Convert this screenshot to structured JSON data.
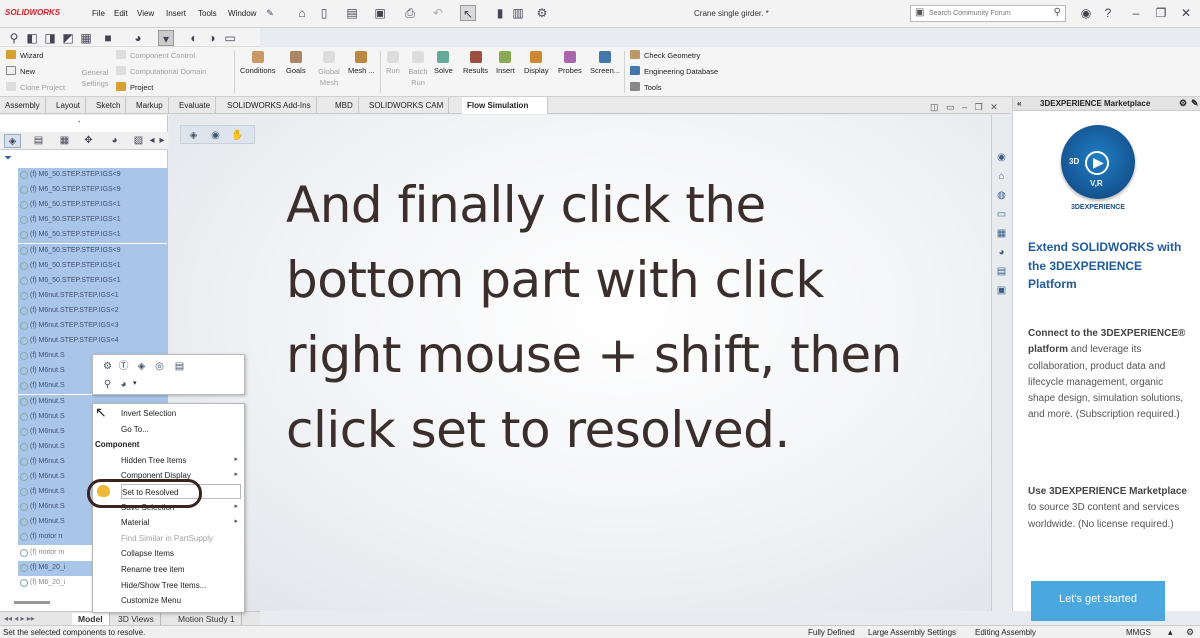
{
  "app": {
    "logo": "SOLIDWORKS",
    "doc_title": "Crane single girder. *"
  },
  "menu": [
    "File",
    "Edit",
    "View",
    "Insert",
    "Tools",
    "Window"
  ],
  "search": {
    "placeholder": "Search Community Forum"
  },
  "command_manager": {
    "left_items": [
      {
        "label": "Wizard",
        "enabled": true
      },
      {
        "label": "New",
        "enabled": true
      },
      {
        "label": "Clone Project",
        "enabled": false
      }
    ],
    "general_settings": "General Settings",
    "center_items": [
      {
        "label": "Component Control",
        "enabled": false
      },
      {
        "label": "Computational Domain",
        "enabled": false
      },
      {
        "label": "Project",
        "enabled": true
      }
    ],
    "buttons": [
      {
        "label": "Conditions",
        "enabled": true
      },
      {
        "label": "Goals",
        "enabled": true
      },
      {
        "label": "Global Mesh",
        "enabled": false
      },
      {
        "label": "Mesh ...",
        "enabled": true
      },
      {
        "label": "Run",
        "enabled": false
      },
      {
        "label": "Batch Run",
        "enabled": false
      },
      {
        "label": "Solve",
        "enabled": true
      },
      {
        "label": "Results",
        "enabled": true
      },
      {
        "label": "Insert",
        "enabled": true
      },
      {
        "label": "Display",
        "enabled": true
      },
      {
        "label": "Probes",
        "enabled": true
      },
      {
        "label": "Screen...",
        "enabled": true
      }
    ],
    "right_items": [
      {
        "label": "Check Geometry"
      },
      {
        "label": "Engineering Database"
      },
      {
        "label": "Tools"
      }
    ]
  },
  "tabs": [
    "Assembly",
    "Layout",
    "Sketch",
    "Markup",
    "Evaluate",
    "SOLIDWORKS Add-Ins",
    "MBD",
    "SOLIDWORKS CAM",
    "Flow Simulation"
  ],
  "active_tab": "Flow Simulation",
  "tree_rows": [
    "(f) M6_50.STEP.STEP.IGS<9",
    "(f) M6_50.STEP.STEP.IGS<9",
    "(f) M6_50.STEP.STEP.IGS<1",
    "(f) M6_50.STEP.STEP.IGS<1",
    "(f) M6_50.STEP.STEP.IGS<1",
    "(f) M6_50.STEP.STEP.IGS<9",
    "(f) M6_50.STEP.STEP.IGS<1",
    "(f) M6_50.STEP.STEP.IGS<1",
    "(f) M6nut.STEP.STEP.IGS<1",
    "(f) M6nut.STEP.STEP.IGS<2",
    "(f) M6nut.STEP.STEP.IGS<3",
    "(f) M6nut.STEP.STEP.IGS<4",
    "(f) M6nut.S",
    "(f) M6nut.S",
    "(f) M6nut.S",
    "(f) M6nut.S",
    "(f) M6nut.S",
    "(f) M6nut.S",
    "(f) M6nut.S",
    "(f) M6nut.S",
    "(f) M6nut.S",
    "(f) M6nut.S",
    "(f) M6nut.S",
    "(f) M6nut.S",
    "(f) motor n",
    "(f) motor m",
    "(f) M6_20_i",
    "(f) M6_20_i"
  ],
  "context_menu": {
    "items": [
      {
        "label": "Invert Selection",
        "type": "item"
      },
      {
        "label": "Go To...",
        "type": "item"
      },
      {
        "label": "Component",
        "type": "header"
      },
      {
        "label": "Hidden Tree Items",
        "type": "submenu"
      },
      {
        "label": "Component Display",
        "type": "submenu"
      },
      {
        "label": "Set to Resolved",
        "type": "highlight"
      },
      {
        "label": "Save Selection",
        "type": "submenu"
      },
      {
        "label": "Material",
        "type": "submenu"
      },
      {
        "label": "Find Similar in PartSupply",
        "type": "disabled"
      },
      {
        "label": "Collapse Items",
        "type": "item"
      },
      {
        "label": "Rename tree item",
        "type": "item"
      },
      {
        "label": "Hide/Show Tree Items...",
        "type": "item"
      },
      {
        "label": "Customize Menu",
        "type": "item"
      }
    ]
  },
  "overlay_text": [
    "And finally click the",
    "bottom part with click",
    "right mouse + shift, then",
    "click set to resolved."
  ],
  "marketplace": {
    "header": "3DEXPERIENCE Marketplace",
    "logo_text": "3D",
    "logo_sub": "V,R",
    "brand": "3DEXPERIENCE",
    "heading": "Extend SOLIDWORKS with the 3DEXPERIENCE Platform",
    "para1_bold": "Connect to the 3DEXPERIENCE® platform",
    "para1_rest": " and leverage its collaboration, product data and lifecycle management, organic shape design, simulation solutions, and more. (Subscription required.)",
    "para2_bold": "Use 3DEXPERIENCE Marketplace",
    "para2_rest": " to source 3D content and services worldwide. (No license required.)",
    "button": "Let's get started"
  },
  "bottom_tabs": [
    "Model",
    "3D Views",
    "Motion Study 1"
  ],
  "status": {
    "message": "Set the selected components to resolve.",
    "state": "Fully Defined",
    "settings": "Large Assembly Settings",
    "mode": "Editing Assembly",
    "units": "MMGS"
  },
  "colors": {
    "selection": "#a9c6e8",
    "accent": "#1f5c9e",
    "button": "#4aa8df",
    "logo_red": "#d8202a"
  }
}
